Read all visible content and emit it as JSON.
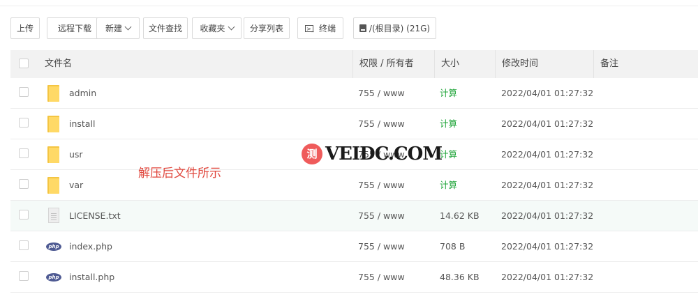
{
  "toolbar": {
    "upload": "上传",
    "remote_download": "远程下载",
    "new": "新建",
    "file_search": "文件查找",
    "favorites": "收藏夹",
    "share_list": "分享列表",
    "terminal": "终端",
    "disk": "/(根目录) (21G)"
  },
  "table": {
    "headers": {
      "name": "文件名",
      "perm_owner": "权限 / 所有者",
      "size": "大小",
      "mtime": "修改时间",
      "note": "备注"
    },
    "rows": [
      {
        "icon": "folder-icon",
        "name": "admin",
        "perm": "755 / www",
        "size": "计算",
        "mtime": "2022/04/01 01:27:32"
      },
      {
        "icon": "folder-icon",
        "name": "install",
        "perm": "755 / www",
        "size": "计算",
        "mtime": "2022/04/01 01:27:32"
      },
      {
        "icon": "folder-icon",
        "name": "usr",
        "perm": "755 / www",
        "size": "计算",
        "mtime": "2022/04/01 01:27:32"
      },
      {
        "icon": "folder-icon",
        "name": "var",
        "perm": "755 / www",
        "size": "计算",
        "mtime": "2022/04/01 01:27:32"
      },
      {
        "icon": "text-file-icon",
        "name": "LICENSE.txt",
        "perm": "755 / www",
        "size": "14.62 KB",
        "mtime": "2022/04/01 01:27:32"
      },
      {
        "icon": "php-file-icon",
        "name": "index.php",
        "perm": "755 / www",
        "size": "708 B",
        "mtime": "2022/04/01 01:27:32"
      },
      {
        "icon": "php-file-icon",
        "name": "install.php",
        "perm": "755 / www",
        "size": "48.36 KB",
        "mtime": "2022/04/01 01:27:32"
      }
    ]
  },
  "php_badge": "php",
  "annotation": "解压后文件所示",
  "watermark": {
    "logo": "测",
    "text": "VEIDC.COM"
  },
  "colors": {
    "accent_green": "#20a53a",
    "annotation_red": "#e0473d",
    "header_bg": "#f2f2f2"
  }
}
